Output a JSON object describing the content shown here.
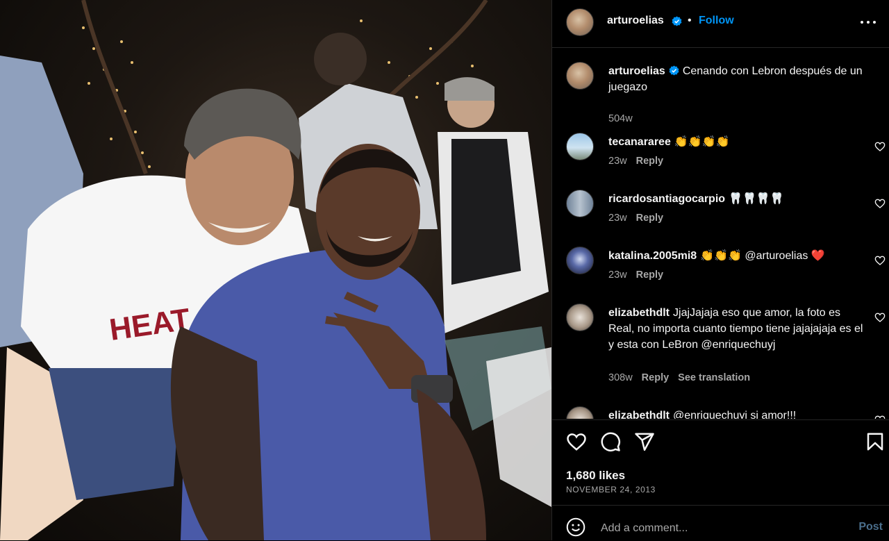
{
  "photo": {
    "alt_subject": "two-men-at-restaurant"
  },
  "header": {
    "username": "arturoelias",
    "separator": "•",
    "follow_label": "Follow",
    "more_icon": "more-options-icon"
  },
  "caption": {
    "username": "arturoelias",
    "text": "Cenando con Lebron después de un juegazo",
    "age": "504w"
  },
  "comments": [
    {
      "username": "tecanararee",
      "text": "👏👏👏👏",
      "age": "23w",
      "reply": "Reply"
    },
    {
      "username": "ricardosantiagocarpio",
      "text": "🦷🦷🦷🦷",
      "age": "23w",
      "reply": "Reply"
    },
    {
      "username": "katalina.2005mi8",
      "text": "👏👏👏 @arturoelias ❤️",
      "age": "23w",
      "reply": "Reply"
    },
    {
      "username": "elizabethdlt",
      "text": "JjajJajaja eso que amor, la foto es Real, no importa cuanto tiempo tiene jajajajaja es el y esta con LeBron @enriquechuyj",
      "age": "308w",
      "reply": "Reply",
      "translate": "See translation"
    },
    {
      "username": "elizabethdlt",
      "text": "@enriquechuyj si amor!!!"
    }
  ],
  "actions": {
    "likes": "1,680 likes",
    "date": "NOVEMBER 24, 2013"
  },
  "add_comment": {
    "placeholder": "Add a comment...",
    "post_label": "Post"
  },
  "colors": {
    "accent": "#0095f6",
    "background": "#000000",
    "secondary_text": "#a8a8a8",
    "divider": "#262626"
  }
}
